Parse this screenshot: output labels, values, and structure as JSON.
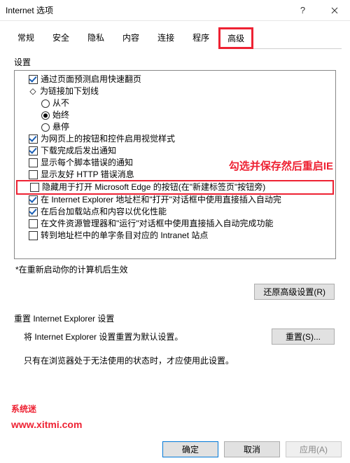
{
  "window": {
    "title": "Internet 选项",
    "help": "?",
    "close": "×"
  },
  "tabs": {
    "items": [
      "常规",
      "安全",
      "隐私",
      "内容",
      "连接",
      "程序",
      "高级"
    ],
    "active_index": 6
  },
  "section_label": "设置",
  "annotation": "勾选并保存然后重启IE",
  "tree": [
    {
      "type": "check",
      "indent": 1,
      "checked": true,
      "label": "通过页面预测启用快速翻页"
    },
    {
      "type": "plain",
      "indent": 1,
      "bullet": "◇",
      "label": "为链接加下划线"
    },
    {
      "type": "radio",
      "indent": 2,
      "checked": false,
      "label": "从不"
    },
    {
      "type": "radio",
      "indent": 2,
      "checked": true,
      "label": "始终"
    },
    {
      "type": "radio",
      "indent": 2,
      "checked": false,
      "label": "悬停"
    },
    {
      "type": "check",
      "indent": 1,
      "checked": true,
      "label": "为网页上的按钮和控件启用视觉样式"
    },
    {
      "type": "check",
      "indent": 1,
      "checked": true,
      "label": "下载完成后发出通知"
    },
    {
      "type": "check",
      "indent": 1,
      "checked": false,
      "label": "显示每个脚本错误的通知"
    },
    {
      "type": "check",
      "indent": 1,
      "checked": false,
      "label": "显示友好 HTTP 错误消息"
    },
    {
      "type": "check",
      "indent": 1,
      "checked": false,
      "label": "隐藏用于打开 Microsoft Edge 的按钮(在\"新建标签页\"按钮旁)",
      "highlight": true
    },
    {
      "type": "check",
      "indent": 1,
      "checked": true,
      "label": "在 Internet Explorer 地址栏和\"打开\"对话框中使用直接插入自动完"
    },
    {
      "type": "check",
      "indent": 1,
      "checked": true,
      "label": "在后台加载站点和内容以优化性能"
    },
    {
      "type": "check",
      "indent": 1,
      "checked": false,
      "label": "在文件资源管理器和\"运行\"对话框中使用直接插入自动完成功能"
    },
    {
      "type": "check",
      "indent": 1,
      "checked": false,
      "label": "转到地址栏中的单字条目对应的 Intranet 站点"
    }
  ],
  "restart_note": "*在重新启动你的计算机后生效",
  "restore_btn": "还原高级设置(R)",
  "reset_group": "重置 Internet Explorer 设置",
  "reset_text": "将 Internet Explorer 设置重置为默认设置。",
  "reset_btn": "重置(S)...",
  "reset_desc": "只有在浏览器处于无法使用的状态时，才应使用此设置。",
  "brand": {
    "name": "系统迷",
    "site": "www.xitmi.com"
  },
  "buttons": {
    "ok": "确定",
    "cancel": "取消",
    "apply": "应用(A)"
  }
}
